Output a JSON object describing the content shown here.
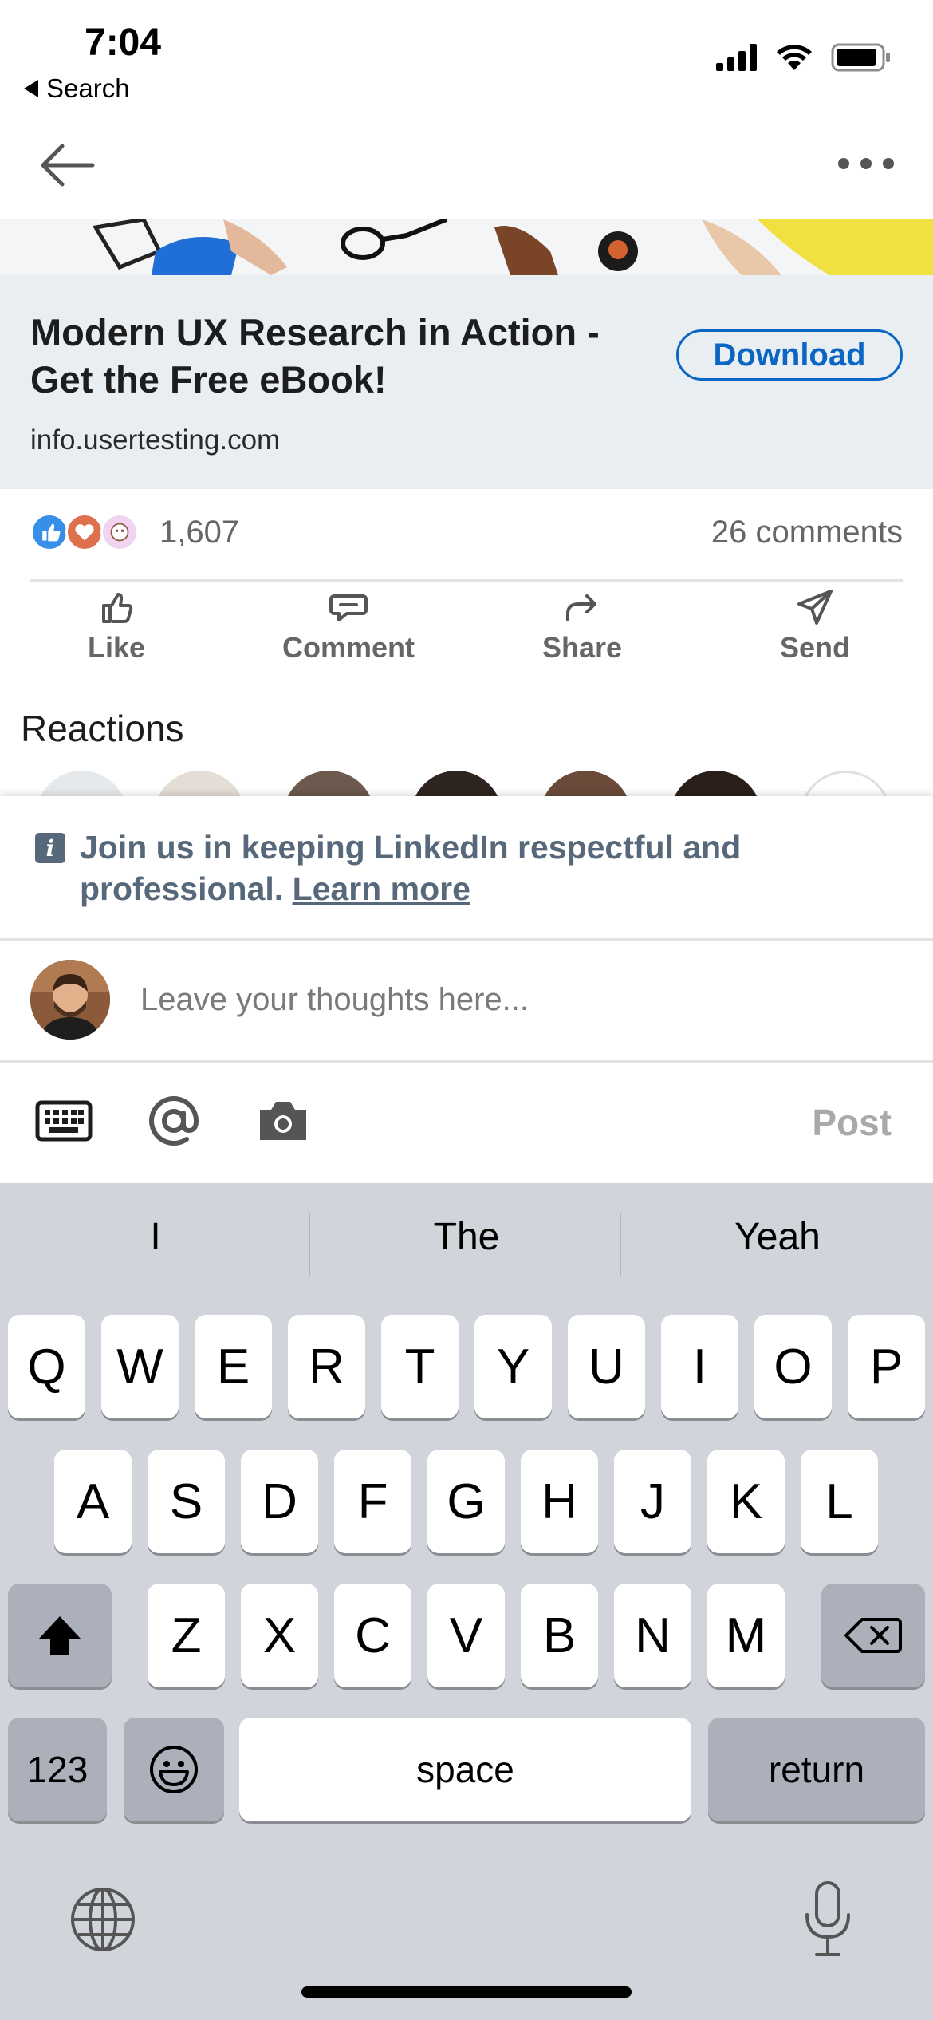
{
  "status_bar": {
    "time": "7:04",
    "back_label": "Search"
  },
  "ad": {
    "headline": "Modern UX Research in Action - Get the Free eBook!",
    "domain": "info.usertesting.com",
    "cta_label": "Download"
  },
  "social": {
    "reaction_count": "1,607",
    "comments_count": "26 comments"
  },
  "actions": {
    "like": "Like",
    "comment": "Comment",
    "share": "Share",
    "send": "Send"
  },
  "reactions_section": {
    "title": "Reactions"
  },
  "notice": {
    "text": "Join us in keeping LinkedIn respectful and professional.",
    "link": "Learn more"
  },
  "composer": {
    "placeholder": "Leave your thoughts here...",
    "post_label": "Post"
  },
  "keyboard": {
    "suggestions": [
      "I",
      "The",
      "Yeah"
    ],
    "row1": [
      "Q",
      "W",
      "E",
      "R",
      "T",
      "Y",
      "U",
      "I",
      "O",
      "P"
    ],
    "row2": [
      "A",
      "S",
      "D",
      "F",
      "G",
      "H",
      "J",
      "K",
      "L"
    ],
    "row3": [
      "Z",
      "X",
      "C",
      "V",
      "B",
      "N",
      "M"
    ],
    "numbers_label": "123",
    "space_label": "space",
    "return_label": "return"
  },
  "colors": {
    "accent": "#0a66c2",
    "notice_text": "#56687a",
    "ad_background": "#e9eef3",
    "keyboard_background": "#d1d4da"
  }
}
